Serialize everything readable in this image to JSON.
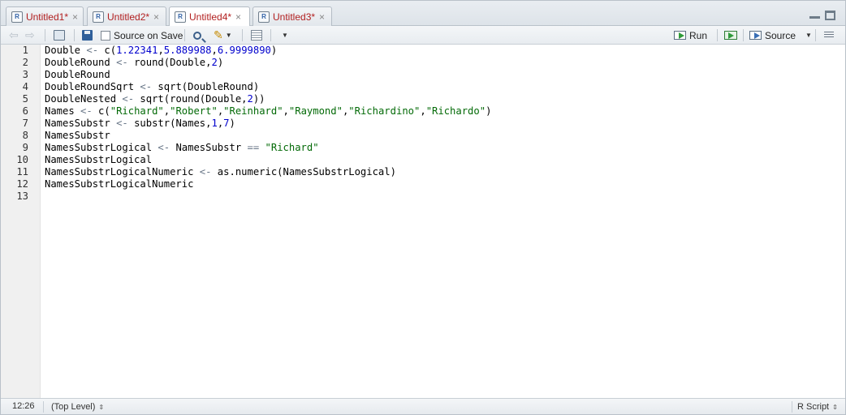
{
  "tabs": [
    {
      "label": "Untitled1*",
      "active": false
    },
    {
      "label": "Untitled2*",
      "active": false
    },
    {
      "label": "Untitled4*",
      "active": true
    },
    {
      "label": "Untitled3*",
      "active": false
    }
  ],
  "toolbar": {
    "source_on_save_label": "Source on Save",
    "run_label": "Run",
    "source_label": "Source"
  },
  "editor": {
    "line_numbers": [
      "1",
      "2",
      "3",
      "4",
      "5",
      "6",
      "7",
      "8",
      "9",
      "10",
      "11",
      "12",
      "13"
    ],
    "lines": [
      [
        {
          "t": "id",
          "v": "Double "
        },
        {
          "t": "op",
          "v": "<-"
        },
        {
          "t": "id",
          "v": " c("
        },
        {
          "t": "num",
          "v": "1.22341"
        },
        {
          "t": "id",
          "v": ","
        },
        {
          "t": "num",
          "v": "5.889988"
        },
        {
          "t": "id",
          "v": ","
        },
        {
          "t": "num",
          "v": "6.9999890"
        },
        {
          "t": "id",
          "v": ")"
        }
      ],
      [
        {
          "t": "id",
          "v": "DoubleRound "
        },
        {
          "t": "op",
          "v": "<-"
        },
        {
          "t": "id",
          "v": " round(Double,"
        },
        {
          "t": "num",
          "v": "2"
        },
        {
          "t": "id",
          "v": ")"
        }
      ],
      [
        {
          "t": "id",
          "v": "DoubleRound"
        }
      ],
      [
        {
          "t": "id",
          "v": "DoubleRoundSqrt "
        },
        {
          "t": "op",
          "v": "<-"
        },
        {
          "t": "id",
          "v": " sqrt(DoubleRound)"
        }
      ],
      [
        {
          "t": "id",
          "v": "DoubleNested "
        },
        {
          "t": "op",
          "v": "<-"
        },
        {
          "t": "id",
          "v": " sqrt(round(Double,"
        },
        {
          "t": "num",
          "v": "2"
        },
        {
          "t": "id",
          "v": "))"
        }
      ],
      [
        {
          "t": "id",
          "v": "Names "
        },
        {
          "t": "op",
          "v": "<-"
        },
        {
          "t": "id",
          "v": " c("
        },
        {
          "t": "str",
          "v": "\"Richard\""
        },
        {
          "t": "id",
          "v": ","
        },
        {
          "t": "str",
          "v": "\"Robert\""
        },
        {
          "t": "id",
          "v": ","
        },
        {
          "t": "str",
          "v": "\"Reinhard\""
        },
        {
          "t": "id",
          "v": ","
        },
        {
          "t": "str",
          "v": "\"Raymond\""
        },
        {
          "t": "id",
          "v": ","
        },
        {
          "t": "str",
          "v": "\"Richardino\""
        },
        {
          "t": "id",
          "v": ","
        },
        {
          "t": "str",
          "v": "\"Richardo\""
        },
        {
          "t": "id",
          "v": ")"
        }
      ],
      [
        {
          "t": "id",
          "v": "NamesSubstr "
        },
        {
          "t": "op",
          "v": "<-"
        },
        {
          "t": "id",
          "v": " substr(Names,"
        },
        {
          "t": "num",
          "v": "1"
        },
        {
          "t": "id",
          "v": ","
        },
        {
          "t": "num",
          "v": "7"
        },
        {
          "t": "id",
          "v": ")"
        }
      ],
      [
        {
          "t": "id",
          "v": "NamesSubstr"
        }
      ],
      [
        {
          "t": "id",
          "v": "NamesSubstrLogical "
        },
        {
          "t": "op",
          "v": "<-"
        },
        {
          "t": "id",
          "v": " NamesSubstr "
        },
        {
          "t": "op",
          "v": "=="
        },
        {
          "t": "id",
          "v": " "
        },
        {
          "t": "str",
          "v": "\"Richard\""
        }
      ],
      [
        {
          "t": "id",
          "v": "NamesSubstrLogical"
        }
      ],
      [
        {
          "t": "id",
          "v": "NamesSubstrLogicalNumeric "
        },
        {
          "t": "op",
          "v": "<-"
        },
        {
          "t": "id",
          "v": " as.numeric(NamesSubstrLogical)"
        }
      ],
      [
        {
          "t": "id",
          "v": "NamesSubstrLogicalNumeric"
        }
      ],
      []
    ]
  },
  "status": {
    "cursor_position": "12:26",
    "scope": "(Top Level)",
    "file_type": "R Script"
  },
  "colors": {
    "tab_label": "#b22020",
    "number": "#0000cd",
    "string": "#036a07",
    "operator": "#687687"
  }
}
